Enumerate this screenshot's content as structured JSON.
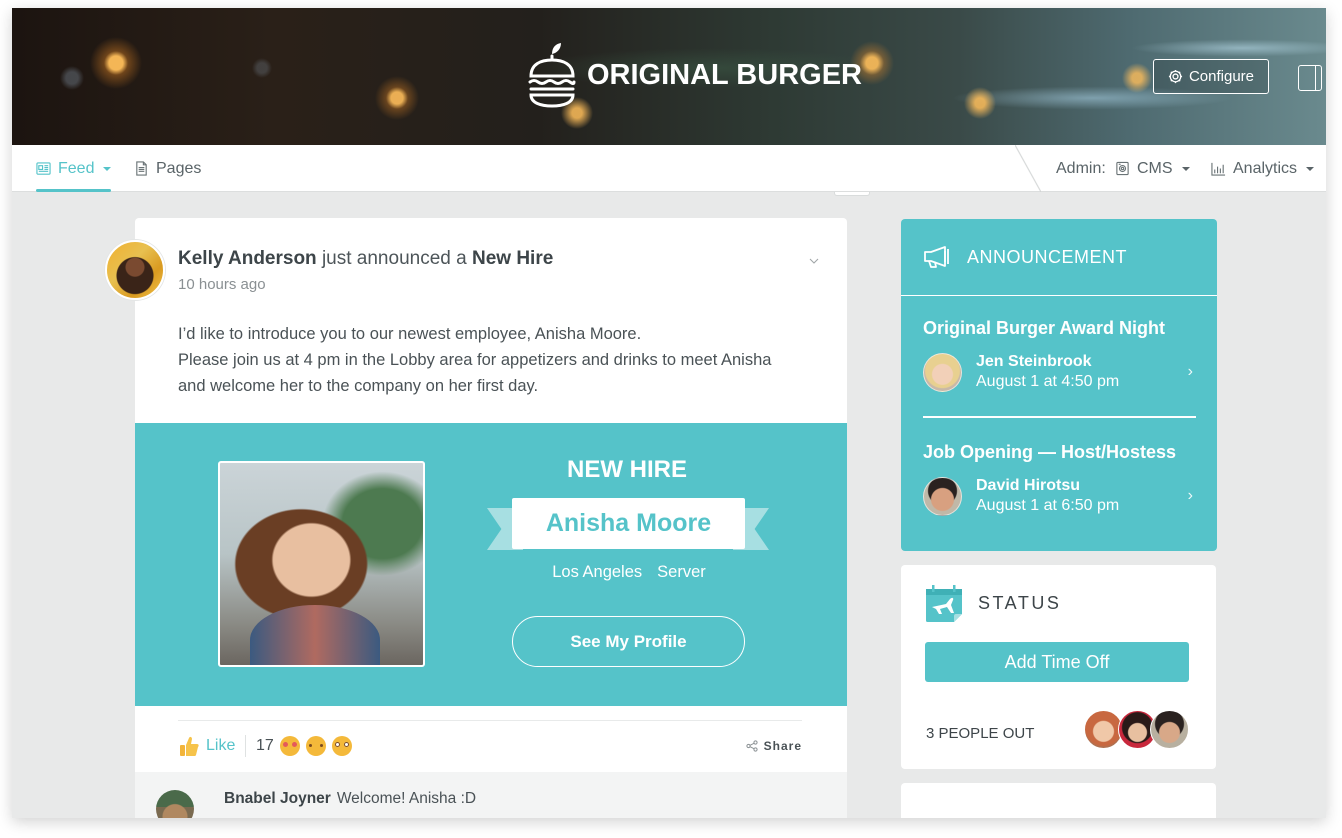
{
  "header": {
    "brand": "ORIGINAL BURGER",
    "logo_icon": "burger-apple-logo-icon",
    "configure_label": "Configure",
    "configure_icon": "gear-icon",
    "panel_toggle_icon": "panel-toggle-icon"
  },
  "nav": {
    "feed_label": "Feed",
    "feed_icon": "feed-icon",
    "pages_label": "Pages",
    "pages_icon": "document-icon",
    "admin_label": "Admin:",
    "cms_label": "CMS",
    "cms_icon": "cms-icon",
    "analytics_label": "Analytics",
    "analytics_icon": "bar-chart-icon"
  },
  "post": {
    "author": "Kelly Anderson",
    "action_text": "just announced a",
    "subject": "New Hire",
    "time": "10 hours ago",
    "body_lines": [
      "I’d like to introduce you to our newest employee, Anisha Moore.",
      "Please join us at 4 pm in the Lobby area for appetizers and drinks to meet Anisha",
      "and welcome her to the company on her first day."
    ],
    "new_hire": {
      "heading": "NEW HIRE",
      "name": "Anisha Moore",
      "location": "Los Angeles",
      "role": "Server",
      "profile_button": "See My Profile"
    },
    "like_label": "Like",
    "reaction_count": "17",
    "reactions": [
      "heart-eyes-emoji",
      "blush-emoji",
      "surprised-emoji"
    ],
    "share_label": "Share",
    "comment": {
      "author": "Bnabel Joyner",
      "text": "Welcome! Anisha :D"
    }
  },
  "announcement": {
    "title": "ANNOUNCEMENT",
    "icon": "megaphone-icon",
    "items": [
      {
        "title": "Original Burger Award Night",
        "person": "Jen Steinbrook",
        "date": "August 1 at 4:50 pm"
      },
      {
        "title": "Job Opening — Host/Hostess",
        "person": "David Hirotsu",
        "date": "August 1 at 6:50 pm"
      }
    ]
  },
  "status": {
    "title": "STATUS",
    "icon": "calendar-plane-icon",
    "button_label": "Add Time Off",
    "people_out_label": "3 PEOPLE OUT",
    "people_out_count": 3
  },
  "colors": {
    "accent": "#55c3c9",
    "background": "#e8e9e9",
    "text_dark": "#3d4549"
  }
}
